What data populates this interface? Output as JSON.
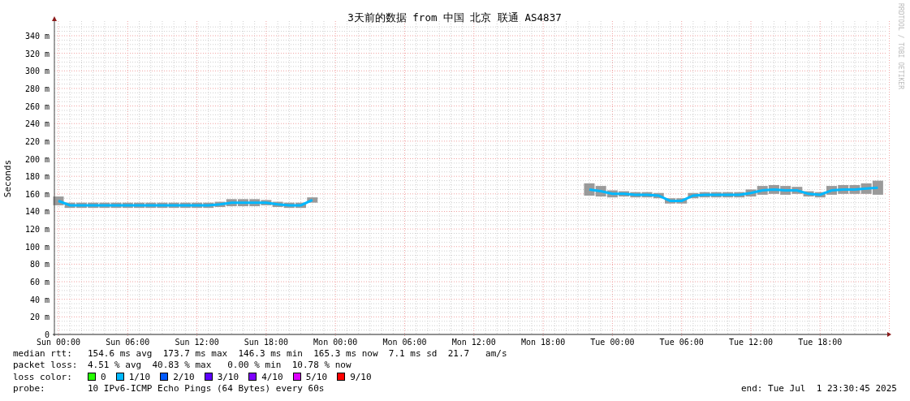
{
  "graph": {
    "watermark": "RRDTOOL / TOBI OETIKER",
    "chart_data": {
      "type": "line",
      "title": "3天前的数据 from 中国 北京 联通 AS4837",
      "ylabel": "Seconds",
      "categories": [
        "Sun 00:00",
        null,
        null,
        null,
        null,
        null,
        "Sun 06:00",
        null,
        null,
        null,
        null,
        null,
        "Sun 12:00",
        null,
        null,
        null,
        null,
        null,
        "Sun 18:00",
        null,
        null,
        null,
        null,
        null,
        "Mon 00:00",
        null,
        null,
        null,
        null,
        null,
        "Mon 06:00",
        null,
        null,
        null,
        null,
        null,
        "Mon 12:00",
        null,
        null,
        null,
        null,
        null,
        "Mon 18:00",
        null,
        null,
        null,
        null,
        null,
        "Tue 00:00",
        null,
        null,
        null,
        null,
        null,
        "Tue 06:00",
        null,
        null,
        null,
        null,
        null,
        "Tue 12:00",
        null,
        null,
        null,
        null,
        null,
        "Tue 18:00",
        null,
        null,
        null,
        null,
        null
      ],
      "series": [
        {
          "color": "#00b8ff",
          "values": [
            152,
            147,
            147,
            147,
            147,
            147,
            147,
            147,
            147,
            147,
            147,
            147,
            147,
            147,
            148,
            150,
            150,
            150,
            150,
            148,
            147,
            147,
            153,
            null,
            null,
            null,
            null,
            null,
            null,
            null,
            null,
            null,
            null,
            null,
            null,
            null,
            null,
            null,
            null,
            null,
            null,
            null,
            null,
            null,
            null,
            null,
            165,
            163,
            160,
            160,
            159,
            159,
            158,
            152,
            152,
            158,
            159,
            159,
            159,
            159,
            161,
            164,
            165,
            164,
            164,
            160,
            159,
            164,
            165,
            165,
            166,
            167
          ],
          "errors": [
            5,
            3,
            3,
            3,
            3,
            3,
            3,
            3,
            3,
            3,
            3,
            3,
            3,
            3,
            3,
            4,
            4,
            4,
            3,
            3,
            3,
            3,
            3,
            null,
            null,
            null,
            null,
            null,
            null,
            null,
            null,
            null,
            null,
            null,
            null,
            null,
            null,
            null,
            null,
            null,
            null,
            null,
            null,
            null,
            null,
            null,
            7,
            6,
            4,
            3,
            3,
            3,
            3,
            3,
            3,
            3,
            3,
            3,
            3,
            3,
            4,
            5,
            5,
            5,
            4,
            3,
            3,
            5,
            5,
            5,
            6,
            8
          ]
        }
      ],
      "grid": true,
      "ylim": [
        0,
        340
      ],
      "yticks": [
        {
          "value": 0,
          "label": "0"
        },
        {
          "value": 20,
          "label": "20 m"
        },
        {
          "value": 40,
          "label": "40 m"
        },
        {
          "value": 60,
          "label": "60 m"
        },
        {
          "value": 80,
          "label": "80 m"
        },
        {
          "value": 100,
          "label": "100 m"
        },
        {
          "value": 120,
          "label": "120 m"
        },
        {
          "value": 140,
          "label": "140 m"
        },
        {
          "value": 160,
          "label": "160 m"
        },
        {
          "value": 180,
          "label": "180 m"
        },
        {
          "value": 200,
          "label": "200 m"
        },
        {
          "value": 220,
          "label": "220 m"
        },
        {
          "value": 240,
          "label": "240 m"
        },
        {
          "value": 260,
          "label": "260 m"
        },
        {
          "value": 280,
          "label": "280 m"
        },
        {
          "value": 300,
          "label": "300 m"
        },
        {
          "value": 320,
          "label": "320 m"
        },
        {
          "value": 340,
          "label": "340 m"
        }
      ]
    }
  },
  "legend": {
    "median_rtt": {
      "label": "median rtt:",
      "value": "154.6 ms avg  173.7 ms max  146.3 ms min  165.3 ms now  7.1 ms sd  21.7   am/s"
    },
    "packet_loss": {
      "label": "packet loss:",
      "value": "4.51 % avg  40.83 % max   0.00 % min  10.78 % now"
    },
    "loss_color": {
      "label": "loss color:",
      "items": [
        {
          "label": "0",
          "color": "#26ff00"
        },
        {
          "label": "1/10",
          "color": "#00b8ff"
        },
        {
          "label": "2/10",
          "color": "#0059ff"
        },
        {
          "label": "3/10",
          "color": "#5e00ff"
        },
        {
          "label": "4/10",
          "color": "#7e00ff"
        },
        {
          "label": "5/10",
          "color": "#dd00ff"
        },
        {
          "label": "9/10",
          "color": "#ff0000"
        }
      ]
    },
    "probe": {
      "label": "probe:",
      "value": "10 IPv6-ICMP Echo Pings (64 Bytes) every 60s"
    },
    "end": "end: Tue Jul  1 23:30:45 2025"
  }
}
